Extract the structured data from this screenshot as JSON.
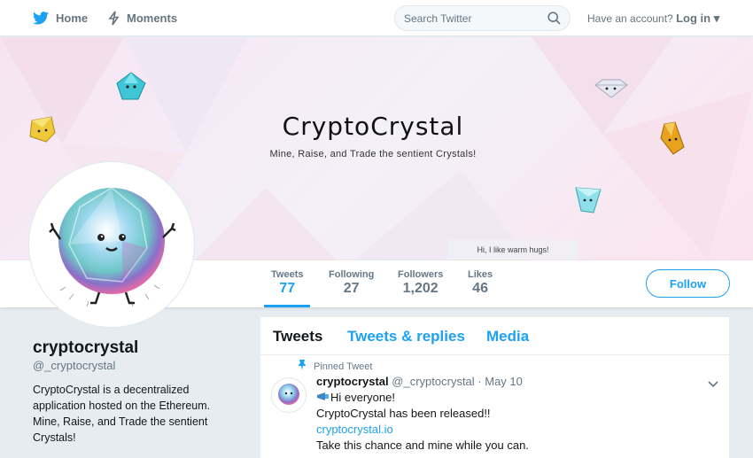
{
  "nav": {
    "home_label": "Home",
    "moments_label": "Moments",
    "search_placeholder": "Search Twitter",
    "account_prompt": "Have an account?",
    "login_label": "Log in",
    "brand_color": "#1da1f2"
  },
  "banner": {
    "title": "CryptoCrystal",
    "subtitle": "Mine, Raise, and Trade the sentient Crystals!",
    "caption": "Hi, I like warm hugs!"
  },
  "stats": [
    {
      "label": "Tweets",
      "value": "77"
    },
    {
      "label": "Following",
      "value": "27"
    },
    {
      "label": "Followers",
      "value": "1,202"
    },
    {
      "label": "Likes",
      "value": "46"
    }
  ],
  "follow_label": "Follow",
  "profile": {
    "name": "cryptocrystal",
    "handle": "@_cryptocrystal",
    "bio": "CryptoCrystal is a decentralized application hosted on the Ethereum. Mine, Raise, and Trade the sentient Crystals!"
  },
  "timeline": {
    "tabs": [
      "Tweets",
      "Tweets & replies",
      "Media"
    ],
    "pinned_label": "Pinned Tweet",
    "tweet": {
      "name": "cryptocrystal",
      "handle": "@_cryptocrystal",
      "date_separator": " · ",
      "date": "May 10",
      "line1": "Hi everyone!",
      "line2": "CryptoCrystal has been released!!",
      "link": "cryptocrystal.io",
      "line4": "Take this chance and mine while you can."
    }
  }
}
